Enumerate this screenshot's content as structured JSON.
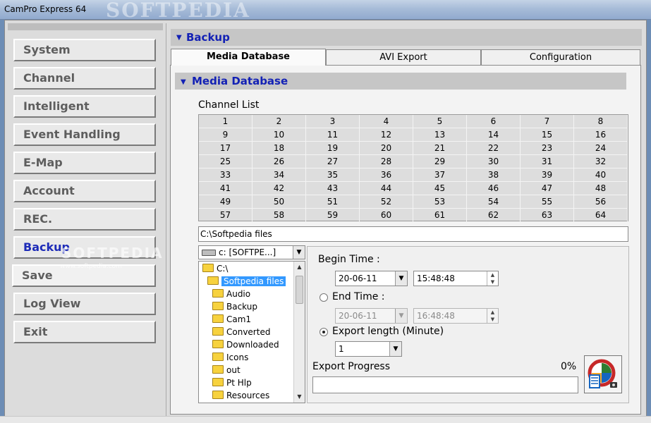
{
  "window": {
    "title": "CamPro Express 64",
    "watermark": "SOFTPEDIA"
  },
  "sidebar": {
    "items": [
      {
        "label": "System",
        "active": false
      },
      {
        "label": "Channel",
        "active": false
      },
      {
        "label": "Intelligent",
        "active": false
      },
      {
        "label": "Event Handling",
        "active": false
      },
      {
        "label": "E-Map",
        "active": false
      },
      {
        "label": "Account",
        "active": false
      },
      {
        "label": "REC.",
        "active": false
      },
      {
        "label": "Backup",
        "active": true
      },
      {
        "label": "Save",
        "active": false
      },
      {
        "label": "Log View",
        "active": false
      },
      {
        "label": "Exit",
        "active": false
      }
    ],
    "watermark": "SOFTPEDIA",
    "watermark_url": "www.softpedia.com"
  },
  "header": {
    "title": "Backup"
  },
  "tabs": [
    {
      "label": "Media Database",
      "active": true
    },
    {
      "label": "AVI Export",
      "active": false
    },
    {
      "label": "Configuration",
      "active": false
    }
  ],
  "media": {
    "section_title": "Media Database",
    "channel_list_label": "Channel List",
    "channels": [
      "1",
      "2",
      "3",
      "4",
      "5",
      "6",
      "7",
      "8",
      "9",
      "10",
      "11",
      "12",
      "13",
      "14",
      "15",
      "16",
      "17",
      "18",
      "19",
      "20",
      "21",
      "22",
      "23",
      "24",
      "25",
      "26",
      "27",
      "28",
      "29",
      "30",
      "31",
      "32",
      "33",
      "34",
      "35",
      "36",
      "37",
      "38",
      "39",
      "40",
      "41",
      "42",
      "43",
      "44",
      "45",
      "46",
      "47",
      "48",
      "49",
      "50",
      "51",
      "52",
      "53",
      "54",
      "55",
      "56",
      "57",
      "58",
      "59",
      "60",
      "61",
      "62",
      "63",
      "64"
    ],
    "path": "C:\\Softpedia files",
    "drive": "c: [SOFTPE...]",
    "tree": [
      {
        "label": "C:\\",
        "level": 0,
        "selected": false,
        "open": true
      },
      {
        "label": "Softpedia files",
        "level": 1,
        "selected": true,
        "open": true
      },
      {
        "label": "Audio",
        "level": 2,
        "selected": false,
        "open": false
      },
      {
        "label": "Backup",
        "level": 2,
        "selected": false,
        "open": false
      },
      {
        "label": "Cam1",
        "level": 2,
        "selected": false,
        "open": false
      },
      {
        "label": "Converted",
        "level": 2,
        "selected": false,
        "open": false
      },
      {
        "label": "Downloaded",
        "level": 2,
        "selected": false,
        "open": false
      },
      {
        "label": "Icons",
        "level": 2,
        "selected": false,
        "open": false
      },
      {
        "label": "out",
        "level": 2,
        "selected": false,
        "open": false
      },
      {
        "label": "Pt Hlp",
        "level": 2,
        "selected": false,
        "open": false
      },
      {
        "label": "Resources",
        "level": 2,
        "selected": false,
        "open": false
      }
    ],
    "begin_time_label": "Begin Time :",
    "begin_date": "20-06-11",
    "begin_time": "15:48:48",
    "end_time_label": "End Time :",
    "end_date": "20-06-11",
    "end_time": "16:48:48",
    "export_length_label": "Export length (Minute)",
    "export_length": "1",
    "export_mode": "length",
    "export_progress_label": "Export Progress",
    "progress_text": "0%",
    "progress_fraction": 0
  },
  "colors": {
    "accent": "#1321b5",
    "panel": "#dcdcdc",
    "header_bar": "#c6c6c6",
    "selection": "#3399ff"
  }
}
